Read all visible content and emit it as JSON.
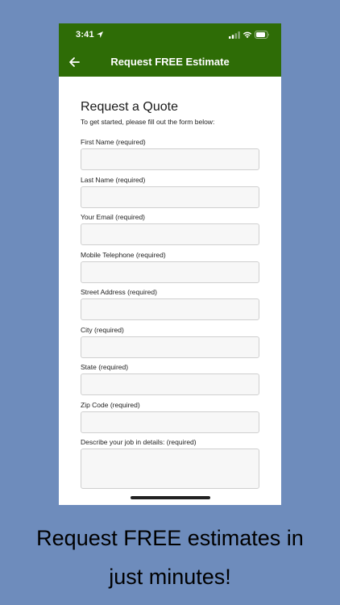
{
  "status_bar": {
    "time": "3:41"
  },
  "nav": {
    "title": "Request FREE Estimate"
  },
  "form": {
    "title": "Request a Quote",
    "subtitle": "To get started, please fill out the form below:",
    "fields": [
      {
        "label": "First Name (required)",
        "value": ""
      },
      {
        "label": "Last Name (required)",
        "value": ""
      },
      {
        "label": "Your Email (required)",
        "value": ""
      },
      {
        "label": "Mobile Telephone (required)",
        "value": ""
      },
      {
        "label": "Street Address (required)",
        "value": ""
      },
      {
        "label": "City (required)",
        "value": ""
      },
      {
        "label": "State (required)",
        "value": ""
      },
      {
        "label": "Zip Code (required)",
        "value": ""
      }
    ],
    "description": {
      "label": "Describe your job in details: (required)",
      "value": ""
    }
  },
  "caption": {
    "line1": "Request FREE estimates in",
    "line2": "just minutes!"
  },
  "colors": {
    "background": "#6e8cbc",
    "header": "#2e6c06",
    "input_bg": "#f7f7f7"
  },
  "icons": {
    "back": "arrow-left-icon",
    "location": "location-arrow-icon",
    "signal": "cellular-signal-icon",
    "wifi": "wifi-icon",
    "battery": "battery-icon"
  }
}
